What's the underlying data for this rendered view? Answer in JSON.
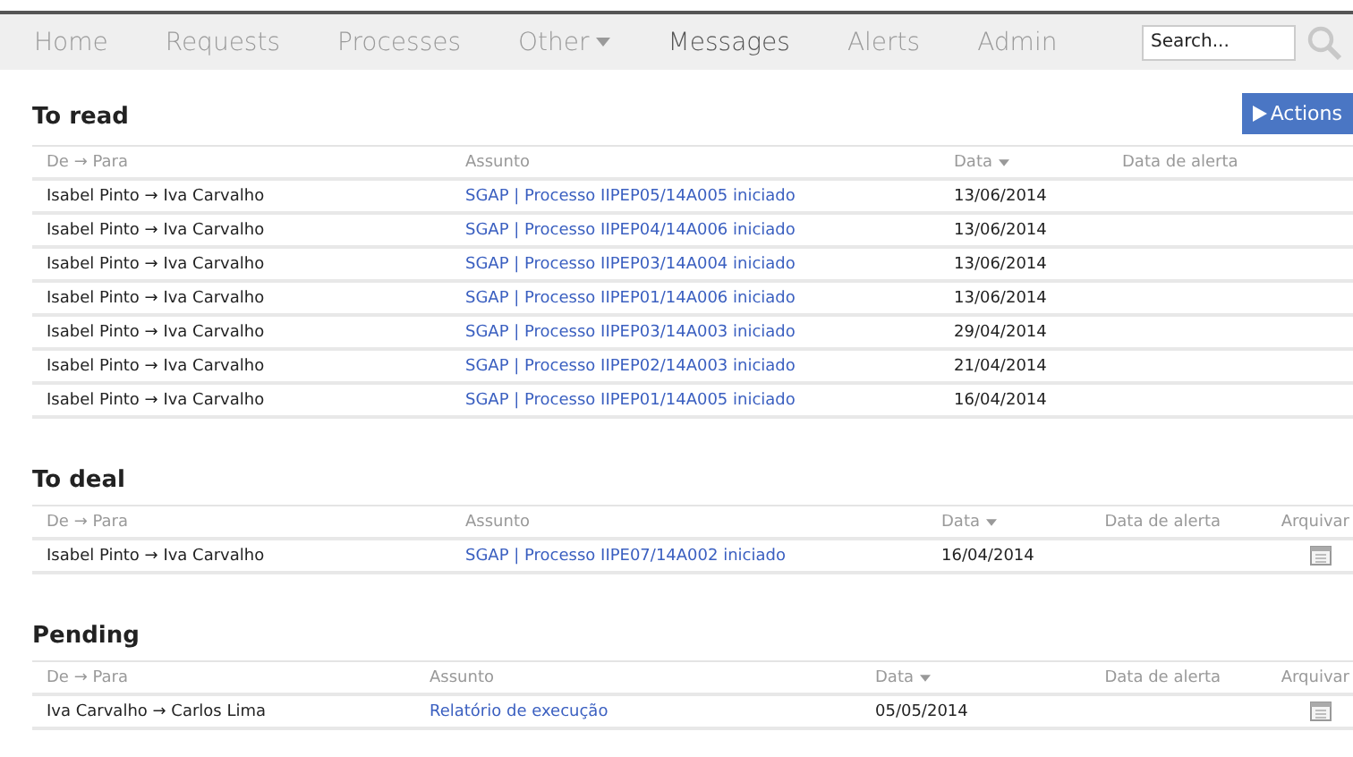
{
  "nav": {
    "items": [
      {
        "label": "Home",
        "selected": false,
        "dropdown": false
      },
      {
        "label": "Requests",
        "selected": false,
        "dropdown": false
      },
      {
        "label": "Processes",
        "selected": false,
        "dropdown": false
      },
      {
        "label": "Other",
        "selected": false,
        "dropdown": true
      },
      {
        "label": "Messages",
        "selected": true,
        "dropdown": false
      },
      {
        "label": "Alerts",
        "selected": false,
        "dropdown": false
      },
      {
        "label": "Admin",
        "selected": false,
        "dropdown": false
      }
    ],
    "search": {
      "placeholder": "Search..."
    }
  },
  "sections": [
    {
      "title": "To read",
      "actions_button": "Actions",
      "columns": [
        {
          "label": "De → Para",
          "sorted": false
        },
        {
          "label": "Assunto",
          "sorted": false
        },
        {
          "label": "Data",
          "sorted": true
        },
        {
          "label": "Data de alerta",
          "sorted": false
        }
      ],
      "rows": [
        {
          "from_to": "Isabel Pinto → Iva Carvalho",
          "subject": "SGAP | Processo IIPEP05/14A005 iniciado",
          "date": "13/06/2014"
        },
        {
          "from_to": "Isabel Pinto → Iva Carvalho",
          "subject": "SGAP | Processo IIPEP04/14A006 iniciado",
          "date": "13/06/2014"
        },
        {
          "from_to": "Isabel Pinto → Iva Carvalho",
          "subject": "SGAP | Processo IIPEP03/14A004 iniciado",
          "date": "13/06/2014"
        },
        {
          "from_to": "Isabel Pinto → Iva Carvalho",
          "subject": "SGAP | Processo IIPEP01/14A006 iniciado",
          "date": "13/06/2014"
        },
        {
          "from_to": "Isabel Pinto → Iva Carvalho",
          "subject": "SGAP | Processo IIPEP03/14A003 iniciado",
          "date": "29/04/2014"
        },
        {
          "from_to": "Isabel Pinto → Iva Carvalho",
          "subject": "SGAP | Processo IIPEP02/14A003 iniciado",
          "date": "21/04/2014"
        },
        {
          "from_to": "Isabel Pinto → Iva Carvalho",
          "subject": "SGAP | Processo IIPEP01/14A005 iniciado",
          "date": "16/04/2014"
        }
      ]
    },
    {
      "title": "To deal",
      "columns": [
        {
          "label": "De → Para",
          "sorted": false
        },
        {
          "label": "Assunto",
          "sorted": false
        },
        {
          "label": "Data",
          "sorted": true
        },
        {
          "label": "Data de alerta",
          "sorted": false
        },
        {
          "label": "Arquivar",
          "sorted": false
        }
      ],
      "rows": [
        {
          "from_to": "Isabel Pinto → Iva Carvalho",
          "subject": "SGAP | Processo IIPE07/14A002 iniciado",
          "date": "16/04/2014"
        }
      ]
    },
    {
      "title": "Pending",
      "columns": [
        {
          "label": "De → Para",
          "sorted": false
        },
        {
          "label": "Assunto",
          "sorted": false
        },
        {
          "label": "Data",
          "sorted": true
        },
        {
          "label": "Data de alerta",
          "sorted": false
        },
        {
          "label": "Arquivar",
          "sorted": false
        }
      ],
      "rows": [
        {
          "from_to": "Iva Carvalho → Carlos Lima",
          "subject": "Relatório de execução",
          "date": "05/05/2014"
        }
      ]
    }
  ]
}
